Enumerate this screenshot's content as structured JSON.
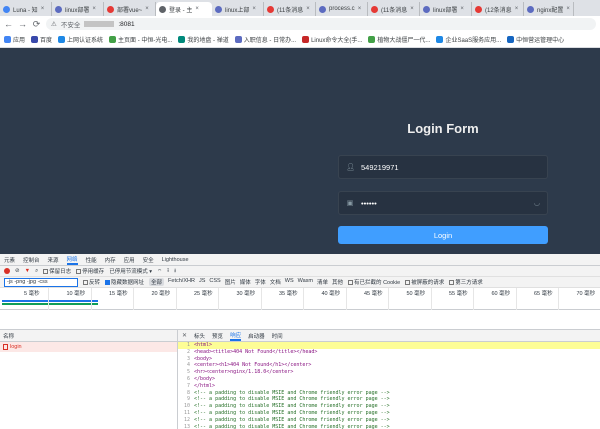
{
  "tabs": [
    {
      "title": "Luna - 知",
      "color": "#4285f4",
      "active": false
    },
    {
      "title": "linux部署",
      "color": "#5c6bc0",
      "active": false
    },
    {
      "title": "部署vue~",
      "color": "#e53935",
      "active": false
    },
    {
      "title": "登录 - 主",
      "color": "#5f6368",
      "active": true
    },
    {
      "title": "linux上部",
      "color": "#5c6bc0",
      "active": false
    },
    {
      "title": "(11条消息",
      "color": "#e53935",
      "active": false
    },
    {
      "title": "process.c",
      "color": "#5c6bc0",
      "active": false
    },
    {
      "title": "(11条消息",
      "color": "#e53935",
      "active": false
    },
    {
      "title": "linux部署",
      "color": "#5c6bc0",
      "active": false
    },
    {
      "title": "(12条消息",
      "color": "#e53935",
      "active": false
    },
    {
      "title": "nginx配置",
      "color": "#5c6bc0",
      "active": false
    }
  ],
  "toolbar": {
    "back": "←",
    "forward": "→",
    "reload": "⟳",
    "security_label": "不安全",
    "address_suffix": ":8081"
  },
  "bookmarks": [
    {
      "label": "应用",
      "color": "#4285f4"
    },
    {
      "label": "百度",
      "color": "#3949ab"
    },
    {
      "label": "上网认证系统",
      "color": "#1e88e5"
    },
    {
      "label": "主页面 - 中恒-光电...",
      "color": "#43a047"
    },
    {
      "label": "我的地盘 - 禅道",
      "color": "#00897b"
    },
    {
      "label": "入职信息 - 日常办...",
      "color": "#5c6bc0"
    },
    {
      "label": "Linux命令大全(手...",
      "color": "#c62828"
    },
    {
      "label": "植物大战僵尸一代...",
      "color": "#43a047"
    },
    {
      "label": "企业SaaS服务应用...",
      "color": "#1e88e5"
    },
    {
      "label": "中恒营运管理中心",
      "color": "#1565c0"
    }
  ],
  "login": {
    "title": "Login Form",
    "username": "549219971",
    "password": "••••••",
    "button": "Login"
  },
  "devtools": {
    "tabs": [
      "元素",
      "控制台",
      "来源",
      "网络",
      "性能",
      "内存",
      "应用",
      "安全",
      "Lighthouse"
    ],
    "active_tab": "网络",
    "row1": {
      "preserve_log": "保留日志",
      "disable_cache": "停用缓存",
      "throttle": "已停用节流模式"
    },
    "row2": {
      "filter": "-js -png -jpg -css",
      "invert": "反转",
      "hide_data_urls": "隐藏数据网址",
      "types": [
        "全部",
        "Fetch/XHR",
        "JS",
        "CSS",
        "图片",
        "媒体",
        "字体",
        "文档",
        "WS",
        "Wasm",
        "清单",
        "其他"
      ],
      "blocked_cookies": "有已拦截的 Cookie",
      "blocked_requests": "被屏蔽的请求",
      "third_party": "第三方请求"
    },
    "timeline_ticks": [
      "5 毫秒",
      "10 毫秒",
      "15 毫秒",
      "20 毫秒",
      "25 毫秒",
      "30 毫秒",
      "35 毫秒",
      "40 毫秒",
      "45 毫秒",
      "50 毫秒",
      "55 毫秒",
      "60 毫秒",
      "65 毫秒",
      "70 毫秒"
    ],
    "request_header": "名称",
    "request_name": "login",
    "detail_tabs": [
      "标头",
      "预览",
      "响应",
      "启动器",
      "时间"
    ],
    "active_detail_tab": "响应",
    "response_lines": [
      {
        "n": "1",
        "text": "<html>",
        "kind": "tag"
      },
      {
        "n": "2",
        "text": "<head><title>404 Not Found</title></head>",
        "kind": "tag"
      },
      {
        "n": "3",
        "text": "<body>",
        "kind": "tag"
      },
      {
        "n": "4",
        "text": "<center><h1>404 Not Found</h1></center>",
        "kind": "tag"
      },
      {
        "n": "5",
        "text": "<hr><center>nginx/1.18.0</center>",
        "kind": "tag"
      },
      {
        "n": "6",
        "text": "</body>",
        "kind": "tag"
      },
      {
        "n": "7",
        "text": "</html>",
        "kind": "tag"
      },
      {
        "n": "8",
        "text": "<!-- a padding to disable MSIE and Chrome friendly error page -->",
        "kind": "cmt"
      },
      {
        "n": "9",
        "text": "<!-- a padding to disable MSIE and Chrome friendly error page -->",
        "kind": "cmt"
      },
      {
        "n": "10",
        "text": "<!-- a padding to disable MSIE and Chrome friendly error page -->",
        "kind": "cmt"
      },
      {
        "n": "11",
        "text": "<!-- a padding to disable MSIE and Chrome friendly error page -->",
        "kind": "cmt"
      },
      {
        "n": "12",
        "text": "<!-- a padding to disable MSIE and Chrome friendly error page -->",
        "kind": "cmt"
      },
      {
        "n": "13",
        "text": "<!-- a padding to disable MSIE and Chrome friendly error page -->",
        "kind": "cmt"
      }
    ]
  }
}
